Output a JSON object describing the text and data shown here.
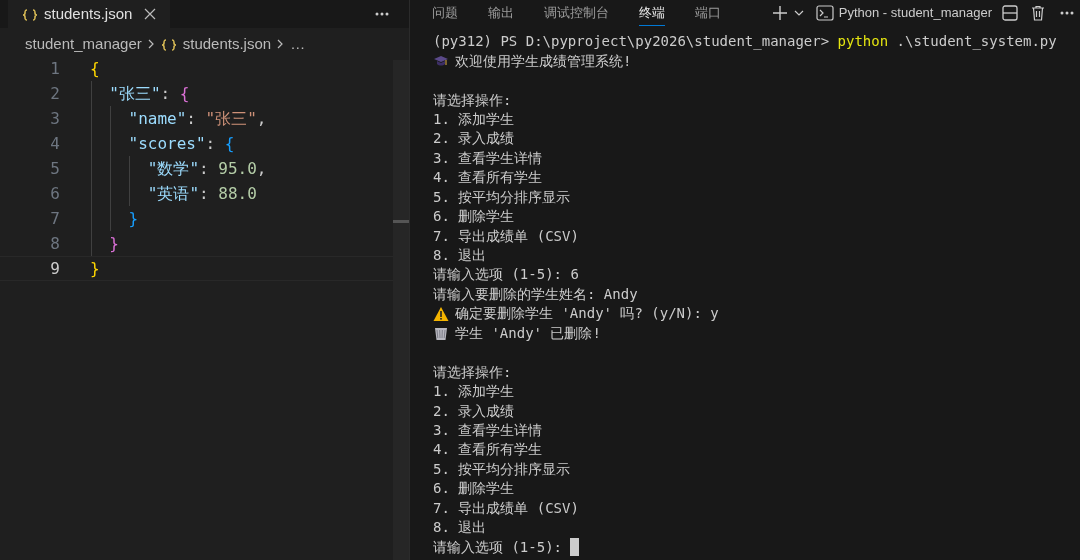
{
  "editor": {
    "tab": {
      "label": "students.json",
      "selected": true
    },
    "breadcrumb": [
      "student_manager",
      "students.json",
      "…"
    ],
    "lines": [
      {
        "number": "1",
        "current": false,
        "tokens": [
          {
            "text": "{",
            "kind": "brace1"
          }
        ]
      },
      {
        "number": "2",
        "current": false,
        "tokens": [
          {
            "text": "  \"张三\"",
            "kind": "key"
          },
          {
            "text": ": ",
            "kind": "punct"
          },
          {
            "text": "{",
            "kind": "brace2"
          }
        ]
      },
      {
        "number": "3",
        "current": false,
        "tokens": [
          {
            "text": "    \"name\"",
            "kind": "key"
          },
          {
            "text": ": ",
            "kind": "punct"
          },
          {
            "text": "\"张三\"",
            "kind": "string"
          },
          {
            "text": ",",
            "kind": "punct"
          }
        ]
      },
      {
        "number": "4",
        "current": false,
        "tokens": [
          {
            "text": "    \"scores\"",
            "kind": "key"
          },
          {
            "text": ": ",
            "kind": "punct"
          },
          {
            "text": "{",
            "kind": "brace3"
          }
        ]
      },
      {
        "number": "5",
        "current": false,
        "tokens": [
          {
            "text": "      \"数学\"",
            "kind": "key"
          },
          {
            "text": ": ",
            "kind": "punct"
          },
          {
            "text": "95.0",
            "kind": "number"
          },
          {
            "text": ",",
            "kind": "punct"
          }
        ]
      },
      {
        "number": "6",
        "current": false,
        "tokens": [
          {
            "text": "      \"英语\"",
            "kind": "key"
          },
          {
            "text": ": ",
            "kind": "punct"
          },
          {
            "text": "88.0",
            "kind": "number"
          }
        ]
      },
      {
        "number": "7",
        "current": false,
        "tokens": [
          {
            "text": "    }",
            "kind": "brace3"
          }
        ]
      },
      {
        "number": "8",
        "current": false,
        "tokens": [
          {
            "text": "  }",
            "kind": "brace2"
          }
        ]
      },
      {
        "number": "9",
        "current": true,
        "tokens": [
          {
            "text": "}",
            "kind": "brace1"
          }
        ]
      }
    ]
  },
  "panel": {
    "tabs": [
      {
        "label": "问题",
        "selected": false
      },
      {
        "label": "输出",
        "selected": false
      },
      {
        "label": "调试控制台",
        "selected": false
      },
      {
        "label": "终端",
        "selected": true
      },
      {
        "label": "端口",
        "selected": false
      }
    ],
    "terminal_name": "Python - student_manager",
    "lines": [
      {
        "segments": [
          {
            "text": "(py312) PS D:\\pyproject\\py2026\\student_manager> ",
            "kind": "plain"
          },
          {
            "text": "python",
            "kind": "command"
          },
          {
            "text": " .\\student_system.py",
            "kind": "plain"
          }
        ]
      },
      {
        "kind": "welcome",
        "segments": [
          {
            "text": "欢迎使用学生成绩管理系统!",
            "kind": "plain"
          }
        ]
      },
      {
        "kind": "blank"
      },
      {
        "segments": [
          {
            "text": "请选择操作:",
            "kind": "plain"
          }
        ]
      },
      {
        "segments": [
          {
            "text": "1. 添加学生",
            "kind": "plain"
          }
        ]
      },
      {
        "segments": [
          {
            "text": "2. 录入成绩",
            "kind": "plain"
          }
        ]
      },
      {
        "segments": [
          {
            "text": "3. 查看学生详情",
            "kind": "plain"
          }
        ]
      },
      {
        "segments": [
          {
            "text": "4. 查看所有学生",
            "kind": "plain"
          }
        ]
      },
      {
        "segments": [
          {
            "text": "5. 按平均分排序显示",
            "kind": "plain"
          }
        ]
      },
      {
        "segments": [
          {
            "text": "6. 删除学生",
            "kind": "plain"
          }
        ]
      },
      {
        "segments": [
          {
            "text": "7. 导出成绩单 (CSV)",
            "kind": "plain"
          }
        ]
      },
      {
        "segments": [
          {
            "text": "8. 退出",
            "kind": "plain"
          }
        ]
      },
      {
        "segments": [
          {
            "text": "请输入选项 (1-5): 6",
            "kind": "plain"
          }
        ]
      },
      {
        "segments": [
          {
            "text": "请输入要删除的学生姓名: Andy",
            "kind": "plain"
          }
        ]
      },
      {
        "kind": "warning",
        "segments": [
          {
            "text": "确定要删除学生 'Andy' 吗? (y/N): y",
            "kind": "plain"
          }
        ]
      },
      {
        "kind": "deleted",
        "segments": [
          {
            "text": "学生 'Andy' 已删除!",
            "kind": "plain"
          }
        ]
      },
      {
        "kind": "blank"
      },
      {
        "segments": [
          {
            "text": "请选择操作:",
            "kind": "plain"
          }
        ]
      },
      {
        "segments": [
          {
            "text": "1. 添加学生",
            "kind": "plain"
          }
        ]
      },
      {
        "segments": [
          {
            "text": "2. 录入成绩",
            "kind": "plain"
          }
        ]
      },
      {
        "segments": [
          {
            "text": "3. 查看学生详情",
            "kind": "plain"
          }
        ]
      },
      {
        "segments": [
          {
            "text": "4. 查看所有学生",
            "kind": "plain"
          }
        ]
      },
      {
        "segments": [
          {
            "text": "5. 按平均分排序显示",
            "kind": "plain"
          }
        ]
      },
      {
        "segments": [
          {
            "text": "6. 删除学生",
            "kind": "plain"
          }
        ]
      },
      {
        "segments": [
          {
            "text": "7. 导出成绩单 (CSV)",
            "kind": "plain"
          }
        ]
      },
      {
        "segments": [
          {
            "text": "8. 退出",
            "kind": "plain"
          }
        ]
      },
      {
        "kind": "prompt",
        "segments": [
          {
            "text": "请输入选项 (1-5): ",
            "kind": "plain"
          }
        ]
      }
    ]
  }
}
